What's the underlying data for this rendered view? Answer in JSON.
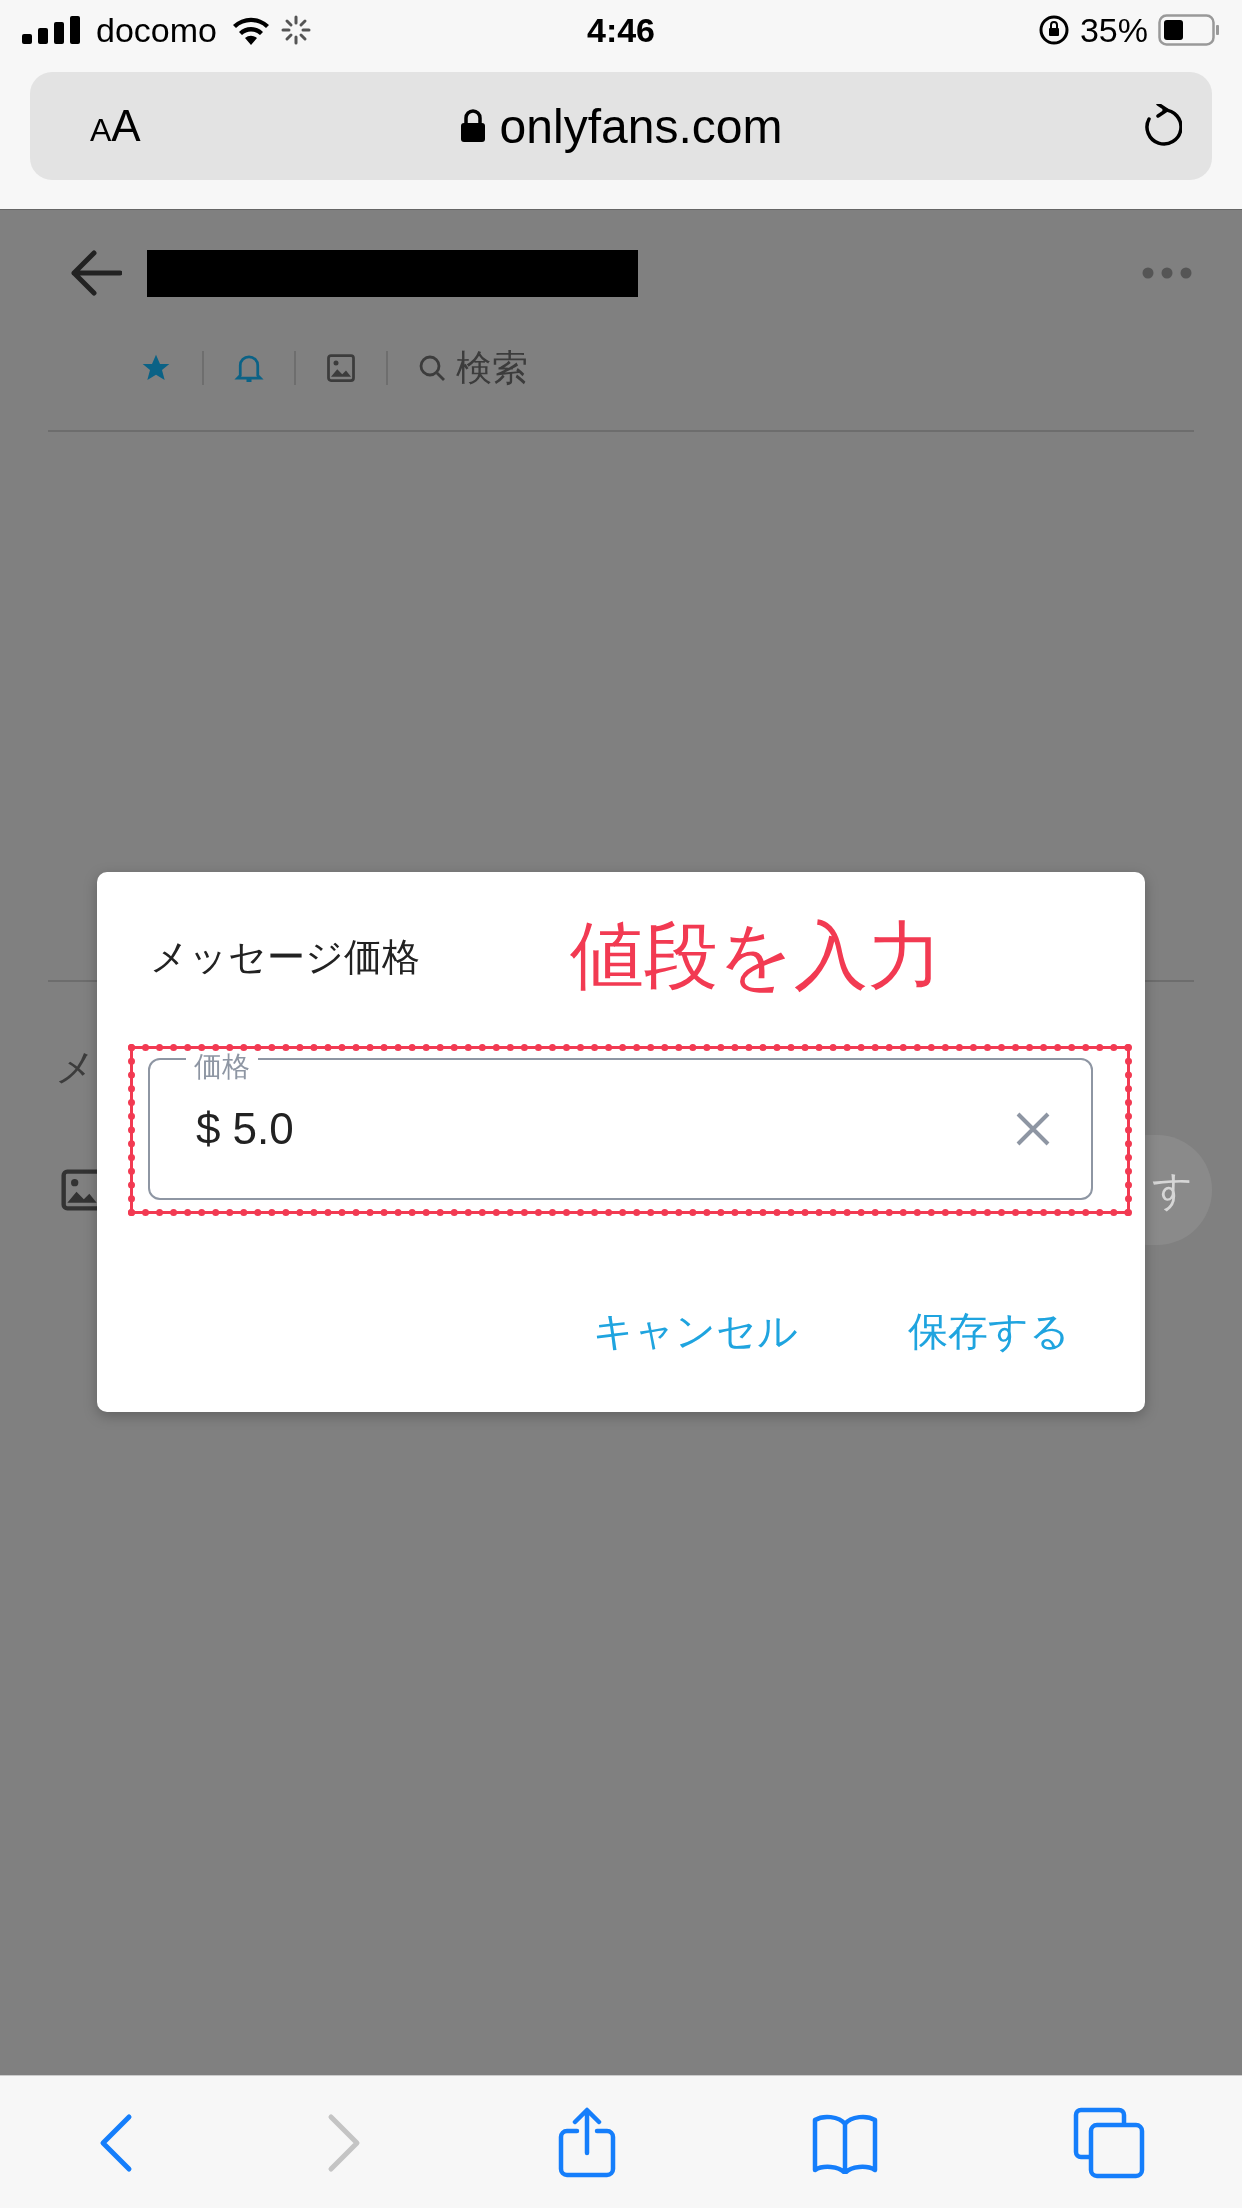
{
  "status_bar": {
    "carrier": "docomo",
    "time": "4:46",
    "battery": "35%"
  },
  "address_bar": {
    "text_size": "AA",
    "url": "onlyfans.com"
  },
  "page": {
    "icons": [
      {
        "kind": "star",
        "active": true
      },
      {
        "kind": "bell",
        "active": true
      },
      {
        "kind": "image",
        "active": false
      }
    ],
    "search_label": "検索",
    "composer_hint": "メ",
    "send_button": "す"
  },
  "dialog": {
    "title": "メッセージ価格",
    "field": {
      "label": "価格",
      "currency": "$",
      "value": "5.0"
    },
    "buttons": [
      "キャンセル",
      "保存する"
    ]
  },
  "annotation": {
    "text": "値段を入力"
  },
  "toolbar": {
    "back_enabled": true,
    "forward_enabled": false
  }
}
